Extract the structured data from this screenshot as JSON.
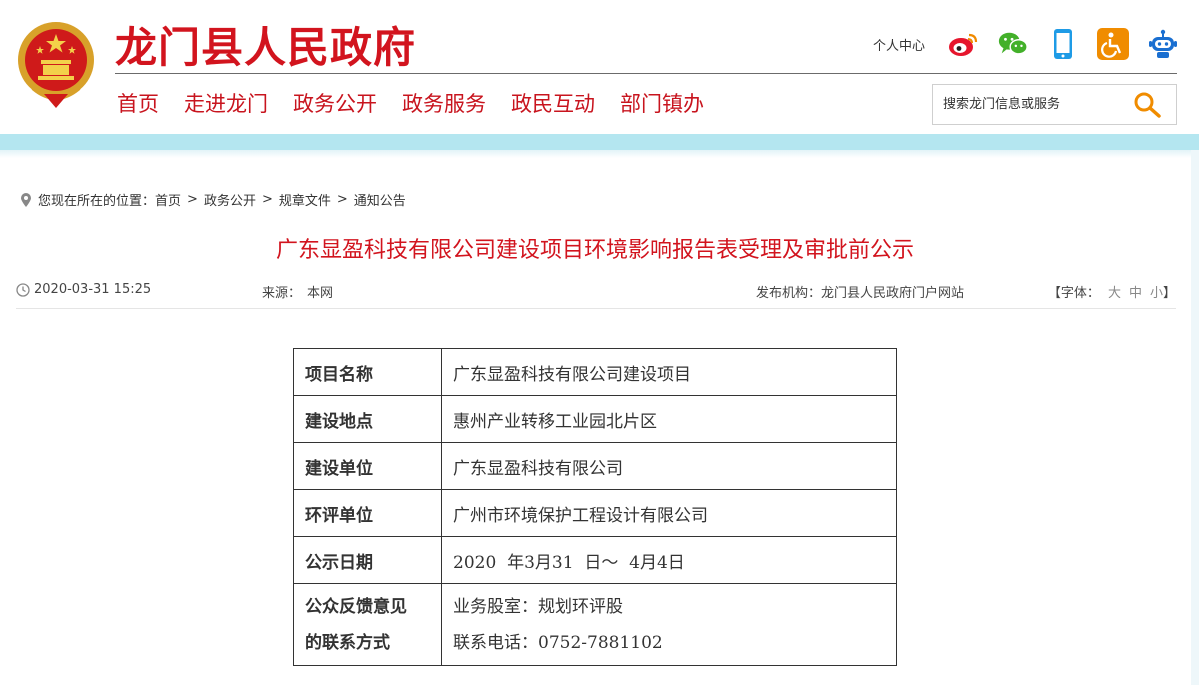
{
  "header": {
    "site_title": "龙门县人民政府",
    "personal_center": "个人中心",
    "icons": [
      "weibo-icon",
      "wechat-icon",
      "mobile-icon",
      "accessibility-icon",
      "robot-icon"
    ],
    "brand_color": "#d2141e"
  },
  "nav": {
    "items": [
      "首页",
      "走进龙门",
      "政务公开",
      "政务服务",
      "政民互动",
      "部门镇办"
    ]
  },
  "search": {
    "placeholder": "搜索龙门信息或服务"
  },
  "breadcrumb": {
    "prefix": "您现在所在的位置：",
    "items": [
      "首页",
      "政务公开",
      "规章文件",
      "通知公告"
    ],
    "separator": ">"
  },
  "article": {
    "title": "广东显盈科技有限公司建设项目环境影响报告表受理及审批前公示",
    "date": "2020-03-31 15:25",
    "source_label": "来源：",
    "source_value": "本网",
    "publisher_label": "发布机构：",
    "publisher_value": "龙门县人民政府门户网站",
    "font_label": "【字体：",
    "font_large": "大",
    "font_medium": "中",
    "font_small": "小",
    "font_close": "】"
  },
  "table": {
    "rows": [
      {
        "key": "项目名称",
        "value": "广东显盈科技有限公司建设项目"
      },
      {
        "key": "建设地点",
        "value": "惠州产业转移工业园北片区"
      },
      {
        "key": "建设单位",
        "value": "广东显盈科技有限公司"
      },
      {
        "key": "环评单位",
        "value": "广州市环境保护工程设计有限公司"
      },
      {
        "key": "公示日期",
        "value": "2020  年3月31  日～  4月4日"
      }
    ],
    "contact": {
      "key_line1": "公众反馈意见",
      "key_line2": "的联系方式",
      "value_line1": "业务股室：规划环评股",
      "value_line2": "联系电话：0752-7881102"
    }
  }
}
